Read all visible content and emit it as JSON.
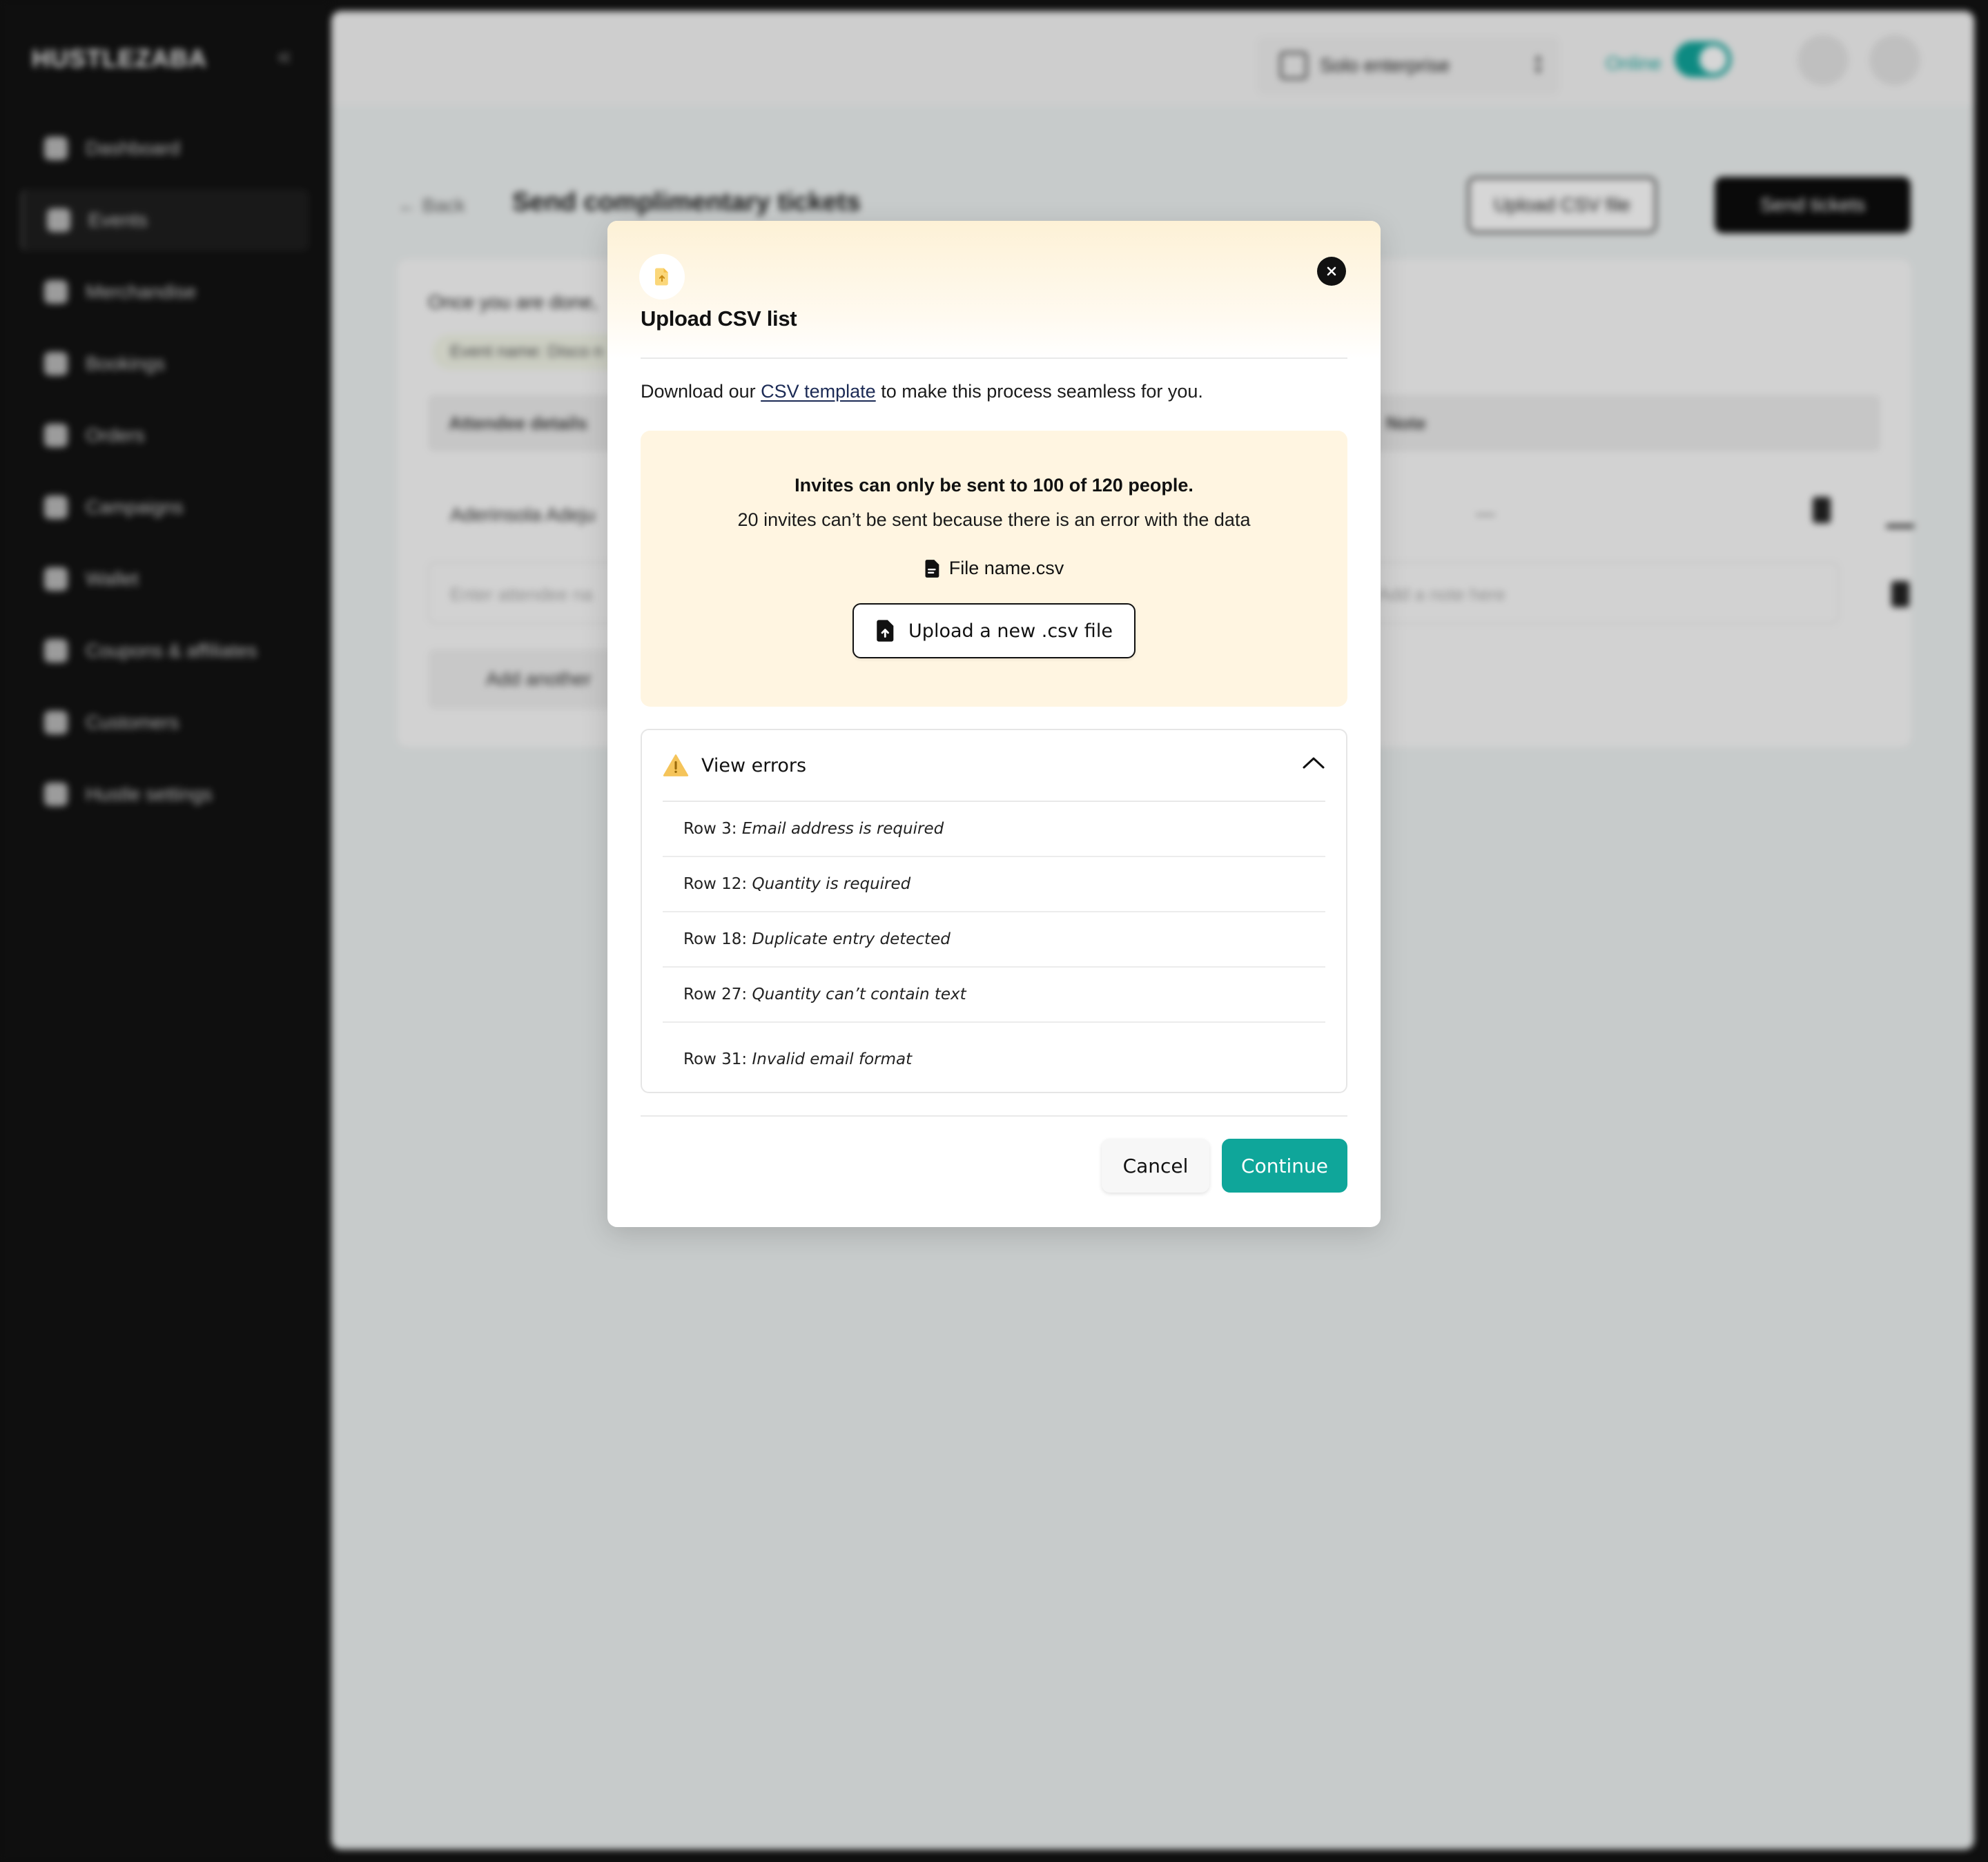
{
  "app": {
    "logo": "HUSTLEZABA",
    "collapse_icon": "double-chevron-left-icon"
  },
  "sidebar": {
    "items": [
      {
        "label": "Dashboard",
        "icon": "dashboard-icon"
      },
      {
        "label": "Events",
        "icon": "events-icon",
        "active": true
      },
      {
        "label": "Merchandise",
        "icon": "merchandise-icon"
      },
      {
        "label": "Bookings",
        "icon": "bookings-icon"
      },
      {
        "label": "Orders",
        "icon": "orders-icon"
      },
      {
        "label": "Campaigns",
        "icon": "campaigns-icon"
      },
      {
        "label": "Wallet",
        "icon": "wallet-icon"
      },
      {
        "label": "Coupons & affiliates",
        "icon": "coupon-icon"
      },
      {
        "label": "Customers",
        "icon": "customers-icon"
      },
      {
        "label": "Hustle settings",
        "icon": "settings-icon"
      }
    ]
  },
  "topbar": {
    "org_name": "Solo enterprise",
    "status_label": "Online",
    "status_on": true
  },
  "page": {
    "back_label": "Back",
    "title": "Send complimentary tickets",
    "upload_csv_label": "Upload CSV file",
    "send_tickets_label": "Send tickets",
    "hint": "Once you are done,",
    "chip": "Event name: Disco n",
    "col_attendee": "Attendee details",
    "col_note": "Note",
    "row_name": "Aderinsola Adeju",
    "row_dash": "—",
    "attendee_placeholder": "Enter attendee na",
    "note_placeholder": "Add a note here",
    "add_another": "Add another"
  },
  "modal": {
    "title": "Upload CSV list",
    "download_prefix": "Download our ",
    "template_link": "CSV template",
    "download_suffix": " to make this process seamless for you.",
    "notice": {
      "title": "Invites can only be sent to 100 of 120 people.",
      "subtitle": "20 invites can’t be sent because there is an error with the data",
      "file_name": "File name.csv",
      "upload_new_label": "Upload a new .csv file"
    },
    "errors": {
      "title": "View errors",
      "expanded": true,
      "rows": [
        {
          "row": "Row 3:",
          "message": "Email address is required"
        },
        {
          "row": "Row 12:",
          "message": "Quantity is required"
        },
        {
          "row": "Row 18:",
          "message": "Duplicate entry detected"
        },
        {
          "row": "Row 27:",
          "message": "Quantity can’t contain text"
        },
        {
          "row": "Row 31:",
          "message": "Invalid email format"
        }
      ]
    },
    "cancel_label": "Cancel",
    "continue_label": "Continue"
  },
  "colors": {
    "accent": "#0fa69a",
    "notice_bg": "#fff5e1",
    "warning": "#f5b93a"
  }
}
